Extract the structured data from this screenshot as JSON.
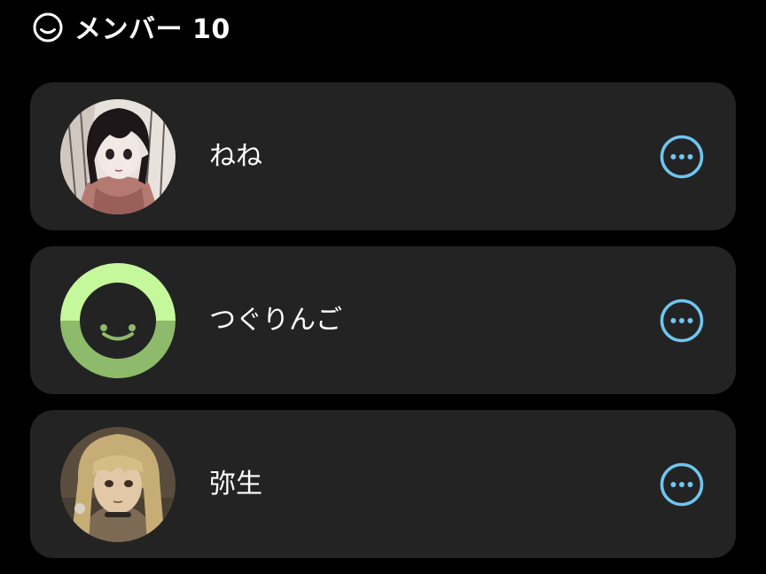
{
  "header": {
    "icon": "smiley-face-icon",
    "title": "メンバー 10"
  },
  "colors": {
    "background": "#000000",
    "card": "#232323",
    "accent": "#6fc6f0",
    "default_avatar_top": "#c5f79b",
    "default_avatar_bottom": "#8dba6b"
  },
  "members": [
    {
      "name": "ねね",
      "avatar": "photo-avatar-dark-hair",
      "more_icon": "more-options-icon"
    },
    {
      "name": "つぐりんご",
      "avatar": "default-green-smiley-avatar",
      "more_icon": "more-options-icon"
    },
    {
      "name": "弥生",
      "avatar": "photo-avatar-blonde-hair",
      "more_icon": "more-options-icon"
    }
  ]
}
